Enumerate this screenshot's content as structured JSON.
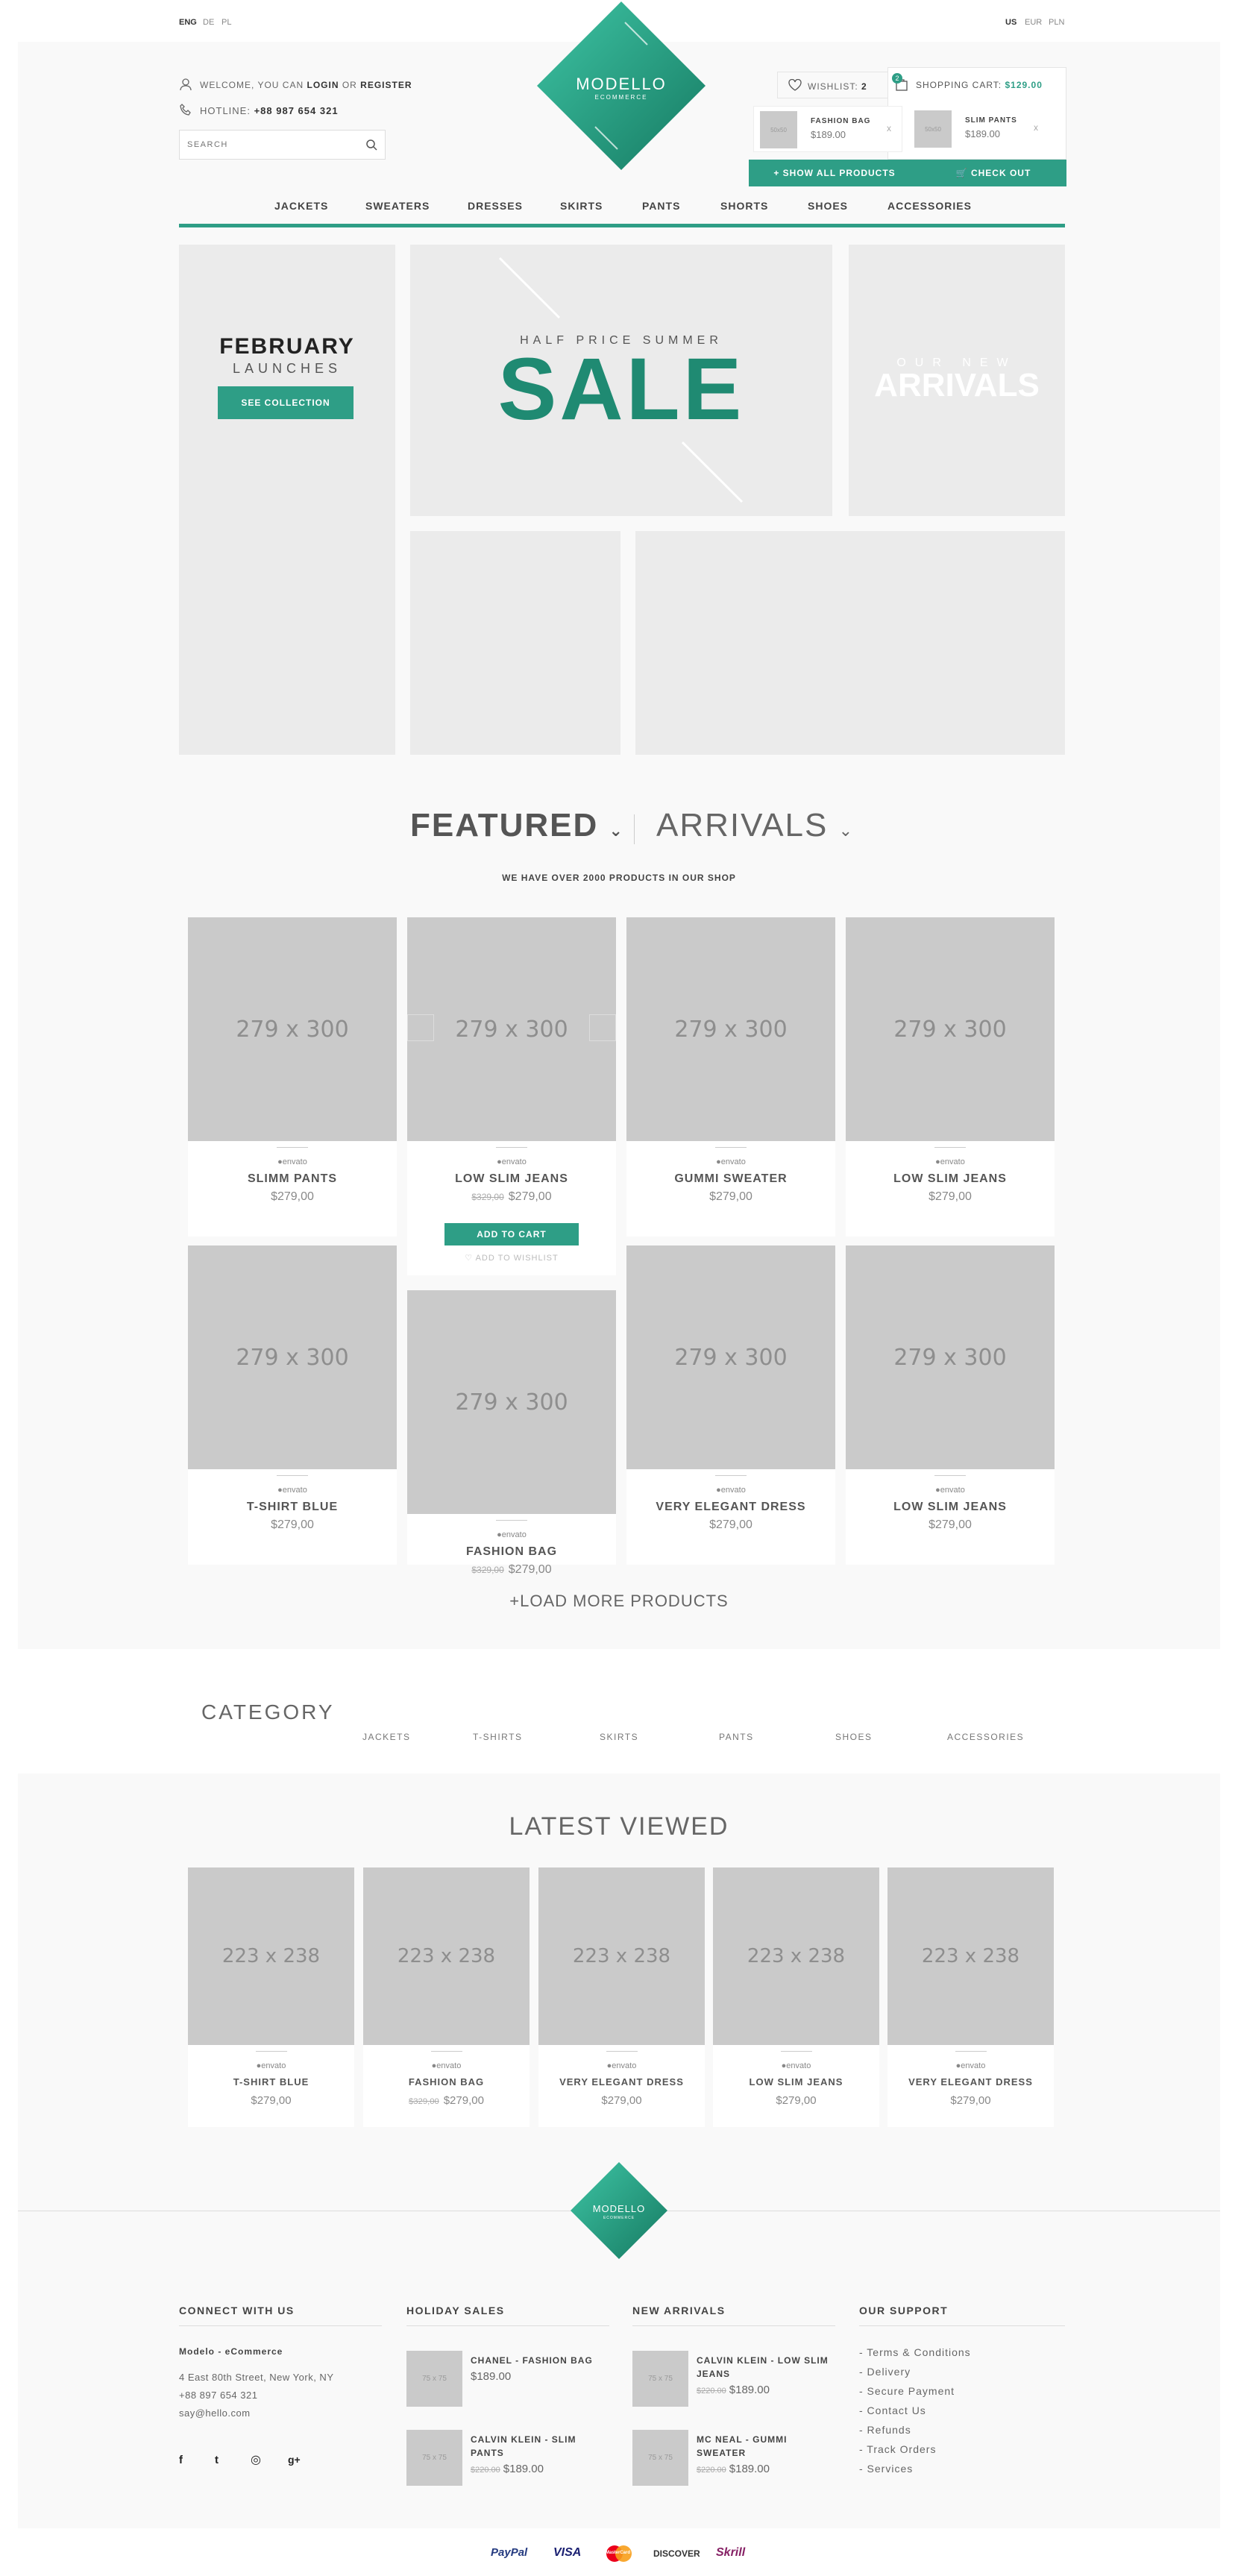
{
  "topbar": {
    "languages": [
      "ENG",
      "DE",
      "PL"
    ],
    "currencies": [
      "US",
      "EUR",
      "PLN"
    ]
  },
  "header": {
    "welcome_prefix": "WELCOME, YOU CAN",
    "login": "LOGIN",
    "or": "OR",
    "register": "REGISTER",
    "hotline_label": "HOTLINE:",
    "hotline": "+88 987 654 321",
    "search_placeholder": "SEARCH",
    "logo_name": "MODELLO",
    "logo_sub": "ECOMMERCE",
    "wishlist_label": "WISHLIST:",
    "wishlist_count": "2",
    "cart_label": "SHOPPING CART:",
    "cart_total": "$129.00",
    "cart_badge": "2",
    "cart_items": [
      {
        "name": "FASHION BAG",
        "price": "$189.00",
        "thumb": "50x50",
        "remove": "x"
      },
      {
        "name": "SLIM PANTS",
        "price": "$189.00",
        "thumb": "50x50",
        "remove": "x"
      }
    ],
    "show_all": "SHOW ALL PRODUCTS",
    "checkout": "CHECK OUT"
  },
  "nav": [
    "JACKETS",
    "SWEATERS",
    "DRESSES",
    "SKIRTS",
    "PANTS",
    "SHORTS",
    "SHOES",
    "ACCESSORIES"
  ],
  "banners": {
    "february_title": "FEBRUARY",
    "february_sub": "LAUNCHES",
    "see_collection": "SEE COLLECTION",
    "sale_small": "HALF PRICE SUMMER",
    "sale_big": "SALE",
    "arrivals_small": "OUR NEW",
    "arrivals_big": "ARRIVALS"
  },
  "featured": {
    "tab_active": "FEATURED",
    "tab_other": "ARRIVALS",
    "subtitle": "WE HAVE OVER 2000 PRODUCTS IN OUR SHOP",
    "load_more": "LOAD MORE PRODUCTS",
    "add_to_cart": "ADD TO CART",
    "add_to_wishlist": "ADD TO WISHLIST",
    "products": [
      {
        "name": "SLIMM PANTS",
        "old": "",
        "price": "$279,00",
        "img": "279 x 300",
        "brand": "●envato"
      },
      {
        "name": "LOW SLIM JEANS",
        "old": "$329,00",
        "price": "$279,00",
        "img": "279 x 300",
        "brand": "●envato"
      },
      {
        "name": "GUMMI SWEATER",
        "old": "",
        "price": "$279,00",
        "img": "279 x 300",
        "brand": "●envato"
      },
      {
        "name": "LOW SLIM JEANS",
        "old": "",
        "price": "$279,00",
        "img": "279 x 300",
        "brand": "●envato"
      },
      {
        "name": "T-SHIRT BLUE",
        "old": "",
        "price": "$279,00",
        "img": "279 x 300",
        "brand": "●envato"
      },
      {
        "name": "FASHION BAG",
        "old": "$329,00",
        "price": "$279,00",
        "img": "279 x 300",
        "brand": "●envato"
      },
      {
        "name": "VERY ELEGANT DRESS",
        "old": "",
        "price": "$279,00",
        "img": "279 x 300",
        "brand": "●envato"
      },
      {
        "name": "LOW SLIM JEANS",
        "old": "",
        "price": "$279,00",
        "img": "279 x 300",
        "brand": "●envato"
      }
    ]
  },
  "category": {
    "title": "CATEGORY",
    "items": [
      "JACKETS",
      "T-SHIRTS",
      "SKIRTS",
      "PANTS",
      "SHOES",
      "ACCESSORIES"
    ]
  },
  "latest": {
    "title": "LATEST VIEWED",
    "products": [
      {
        "name": "T-SHIRT BLUE",
        "old": "",
        "price": "$279,00",
        "img": "223 x 238",
        "brand": "●envato"
      },
      {
        "name": "FASHION BAG",
        "old": "$329,00",
        "price": "$279,00",
        "img": "223 x 238",
        "brand": "●envato"
      },
      {
        "name": "VERY ELEGANT DRESS",
        "old": "",
        "price": "$279,00",
        "img": "223 x 238",
        "brand": "●envato"
      },
      {
        "name": "LOW SLIM JEANS",
        "old": "",
        "price": "$279,00",
        "img": "223 x 238",
        "brand": "●envato"
      },
      {
        "name": "VERY ELEGANT DRESS",
        "old": "",
        "price": "$279,00",
        "img": "223 x 238",
        "brand": "●envato"
      }
    ]
  },
  "footer": {
    "connect_title": "CONNECT WITH US",
    "company": "Modelo - eCommerce",
    "address": "4 East 80th Street, New York, NY",
    "phone": "+88  897 654 321",
    "email": "say@hello.com",
    "social": [
      "f",
      "t",
      "◎",
      "g+"
    ],
    "holiday_title": "HOLIDAY SALES",
    "holiday": [
      {
        "name": "CHANEL - FASHION BAG",
        "old": "",
        "price": "$189.00",
        "thumb": "75 x 75"
      },
      {
        "name": "CALVIN KLEIN - SLIM PANTS",
        "old": "$220.00",
        "price": "$189.00",
        "thumb": "75 x 75"
      }
    ],
    "arrivals_title": "NEW ARRIVALS",
    "arrivals": [
      {
        "name": "CALVIN KLEIN - LOW SLIM JEANS",
        "old": "$220.00",
        "price": "$189.00",
        "thumb": "75 x 75"
      },
      {
        "name": "MC NEAL - GUMMI SWEATER",
        "old": "$220.00",
        "price": "$189.00",
        "thumb": "75 x 75"
      }
    ],
    "support_title": "OUR SUPPORT",
    "support": [
      "- Terms & Conditions",
      "- Delivery",
      "- Secure Payment",
      "- Contact Us",
      "- Refunds",
      "- Track Orders",
      "- Services"
    ],
    "payments": [
      "PayPal",
      "VISA",
      "MasterCard",
      "DISCOVER",
      "Skrill"
    ]
  },
  "colors": {
    "accent": "#2e9e86",
    "placeholder": "#cacaca",
    "panel": "#ebebeb"
  }
}
